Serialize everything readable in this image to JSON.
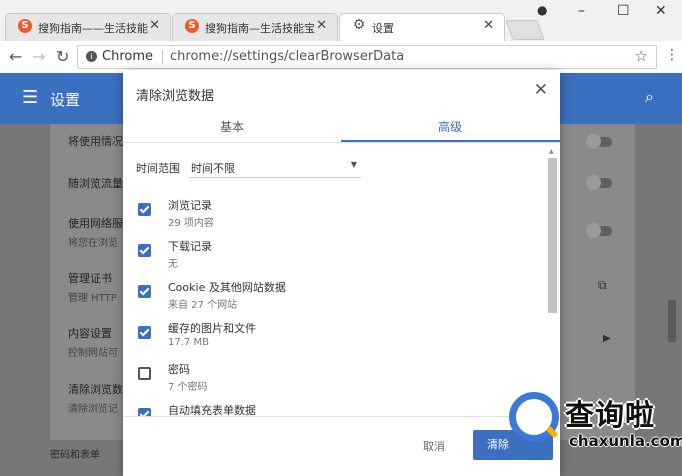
{
  "browser": {
    "tabs": [
      {
        "title": "搜狗指南——生活技能宝",
        "icon": "sogou-favicon",
        "active": false
      },
      {
        "title": "搜狗指南—生活技能宝典",
        "icon": "sogou-favicon",
        "active": false
      },
      {
        "title": "设置",
        "icon": "gear-icon",
        "active": true
      }
    ],
    "omnibox": {
      "chip": "Chrome",
      "url": "chrome://settings/clearBrowserData"
    }
  },
  "settings": {
    "title": "设置",
    "rows": [
      {
        "label": "将使用情况"
      },
      {
        "label": "随浏览流量"
      },
      {
        "label": "使用网络服",
        "sub": "将您在浏览"
      },
      {
        "label": "管理证书",
        "sub": "管理 HTTP"
      },
      {
        "label": "内容设置",
        "sub": "控制网站可"
      },
      {
        "label": "清除浏览数",
        "sub": "清除浏览记"
      }
    ],
    "section_passwords": "密码和表单"
  },
  "dialog": {
    "title": "清除浏览数据",
    "tabs": [
      "基本",
      "高级"
    ],
    "active_tab": 1,
    "time_range_label": "时间范围",
    "time_range_value": "时间不限",
    "items": [
      {
        "label": "浏览记录",
        "sub": "29 项内容",
        "checked": true
      },
      {
        "label": "下载记录",
        "sub": "无",
        "checked": true
      },
      {
        "label": "Cookie 及其他网站数据",
        "sub": "来自 27 个网站",
        "checked": true
      },
      {
        "label": "缓存的图片和文件",
        "sub": "17.7 MB",
        "checked": true
      },
      {
        "label": "密码",
        "sub": "7 个密码",
        "checked": false
      },
      {
        "label": "自动填充表单数据",
        "sub": "",
        "checked": true
      }
    ],
    "cancel_label": "取消",
    "confirm_label": "清除"
  },
  "watermark": {
    "text": "查询啦",
    "domain": "chaxunla.com"
  },
  "colors": {
    "accent": "#3b6fbf",
    "brand_orange": "#f05a28"
  }
}
